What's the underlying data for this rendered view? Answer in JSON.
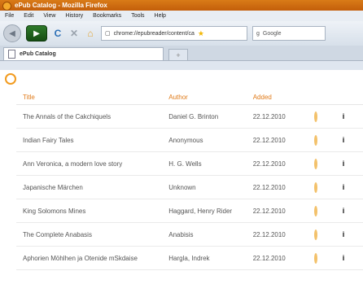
{
  "window": {
    "title": "ePub Catalog - Mozilla Firefox"
  },
  "menu": [
    "File",
    "Edit",
    "View",
    "History",
    "Bookmarks",
    "Tools",
    "Help"
  ],
  "nav": {
    "url": "chrome://epubreader/content/ca",
    "search_placeholder": "Google"
  },
  "tabs": [
    {
      "label": "ePub Catalog"
    }
  ],
  "table": {
    "headers": [
      "Title",
      "Author",
      "Added"
    ],
    "rows": [
      {
        "title": "The Annals of the Cakchiquels",
        "author": "Daniel G. Brinton",
        "added": "22.12.2010"
      },
      {
        "title": "Indian Fairy Tales",
        "author": "Anonymous",
        "added": "22.12.2010"
      },
      {
        "title": "Ann Veronica, a modern love story",
        "author": "H. G. Wells",
        "added": "22.12.2010"
      },
      {
        "title": "Japanische Märchen",
        "author": "Unknown",
        "added": "22.12.2010"
      },
      {
        "title": "King Solomons Mines",
        "author": "Haggard, Henry Rider",
        "added": "22.12.2010"
      },
      {
        "title": "The Complete Anabasis",
        "author": "Anabisis",
        "added": "22.12.2010"
      },
      {
        "title": "Aphorien Möhlhen ja Otenide mSkdaise",
        "author": "Hargla, Indrek",
        "added": "22.12.2010"
      }
    ]
  },
  "colors": {
    "accent": "#e07b1a"
  }
}
